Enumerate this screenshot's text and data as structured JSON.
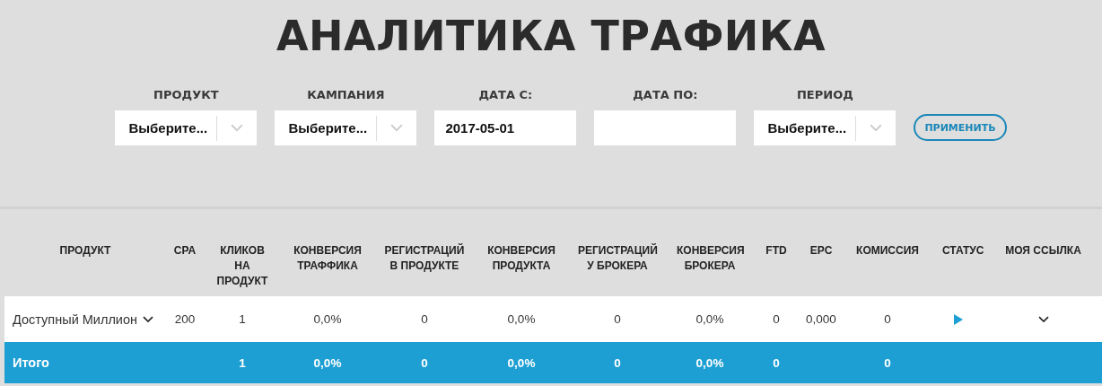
{
  "title": "АНАЛИТИКА ТРАФИКА",
  "filters": [
    {
      "label": "ПРОДУКТ",
      "kind": "select",
      "value": "Выберите..."
    },
    {
      "label": "КАМПАНИЯ",
      "kind": "select",
      "value": "Выберите..."
    },
    {
      "label": "ДАТА С:",
      "kind": "date",
      "value": "2017-05-01"
    },
    {
      "label": "ДАТА ПО:",
      "kind": "date"
    },
    {
      "label": "ПЕРИОД",
      "kind": "select",
      "value": "Выберите..."
    }
  ],
  "apply_button": "ПРИМЕНИТЬ",
  "table": {
    "columns": [
      "ПРОДУКТ",
      "CPA",
      "КЛИКОВ НА ПРОДУКТ",
      "КОНВЕРСИЯ ТРАФФИКА",
      "РЕГИСТРАЦИЙ В ПРОДУКТЕ",
      "КОНВЕРСИЯ ПРОДУКТА",
      "РЕГИСТРАЦИЙ У БРОКЕРА",
      "КОНВЕРСИЯ БРОКЕРА",
      "FTD",
      "EPC",
      "КОМИССИЯ",
      "СТАТУС",
      "МОЯ ССЫЛКА"
    ],
    "rows": [
      {
        "cells": [
          "Доступный Миллион",
          "200",
          "1",
          "0,0%",
          "0",
          "0,0%",
          "0",
          "0,0%",
          "0",
          "0,000",
          "0"
        ]
      }
    ],
    "total": {
      "cells": [
        "Итого",
        "",
        "1",
        "0,0%",
        "0",
        "0,0%",
        "0",
        "0,0%",
        "0",
        "",
        "0"
      ]
    }
  }
}
